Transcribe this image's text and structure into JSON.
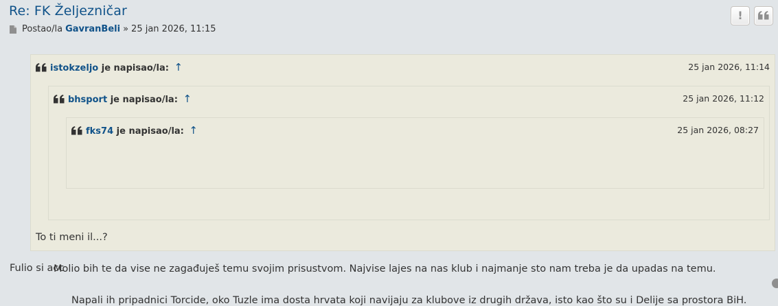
{
  "post": {
    "title": "Re: FK Željezničar",
    "meta": {
      "prefix": "Postao/la",
      "author": "GavranBeli",
      "separator": "»",
      "date": "25 jan 2026, 11:15"
    },
    "actions": [
      {
        "icon": "exclamation-icon",
        "label": "!"
      },
      {
        "icon": "quote-icon",
        "label": "quote"
      }
    ],
    "quotes": {
      "outer": {
        "author": "istokzeljo",
        "wrote": "je napisao/la:",
        "arrow": "↑",
        "date": "25 jan 2026, 11:14",
        "text": "To ti meni il...?"
      },
      "middle": {
        "author": "bhsport",
        "wrote": "je napisao/la:",
        "arrow": "↑",
        "date": "25 jan 2026, 11:12",
        "text": "Molio bih te da vise ne zagađuješ temu svojim prisustvom. Najvise lajes na nas klub i najmanje sto nam treba je da upadas na temu."
      },
      "inner": {
        "author": "fks74",
        "wrote": "je napisao/la:",
        "arrow": "↑",
        "date": "25 jan 2026, 08:27",
        "text": "Napali ih pripadnici Torcide, oko Tuzle ima dosta hrvata koji navijaju za klubove iz drugih država, isto kao što su i Delije sa prostora BiH."
      }
    },
    "body": "Fulio si acc"
  },
  "colors": {
    "background": "#e1e5e8",
    "link": "#105289",
    "quote_background": "#ebeadd",
    "quote_border": "#dbdbce",
    "text": "#333333"
  }
}
